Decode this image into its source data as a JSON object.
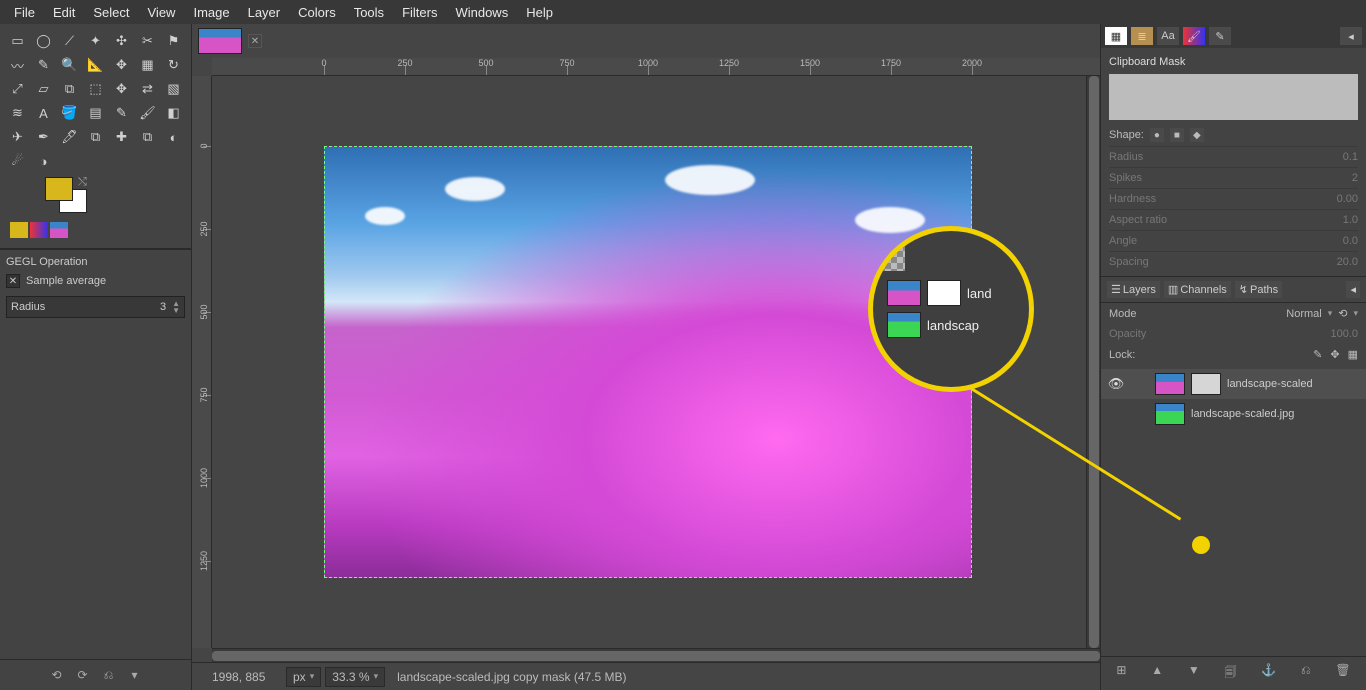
{
  "menubar": [
    "File",
    "Edit",
    "Select",
    "View",
    "Image",
    "Layer",
    "Colors",
    "Tools",
    "Filters",
    "Windows",
    "Help"
  ],
  "toolbox": {
    "tool_names": [
      "rect-select",
      "ellipse-select",
      "free-select",
      "fuzzy-select",
      "color-select",
      "scissors",
      "foreground-select",
      "paths",
      "color-picker",
      "zoom",
      "measure",
      "move",
      "align",
      "rotate",
      "scale",
      "shear",
      "perspective",
      "unified-transform",
      "handle-transform",
      "flip",
      "cage",
      "warp",
      "text",
      "bucket-fill",
      "gradient",
      "pencil",
      "paintbrush",
      "eraser",
      "airbrush",
      "ink",
      "mypaint",
      "clone",
      "heal",
      "perspective-clone",
      "blur-sharpen",
      "smudge",
      "dodge-burn"
    ],
    "glyphs": [
      "▭",
      "◯",
      "⟋",
      "✦",
      "✣",
      "✂",
      "⚑",
      "〰",
      "✎",
      "🔍",
      "📐",
      "✥",
      "▦",
      "↻",
      "⤢",
      "▱",
      "⧉",
      "⬚",
      "✥",
      "⇄",
      "▧",
      "≋",
      "A",
      "🪣",
      "▤",
      "✎",
      "🖌",
      "◧",
      "✈",
      "✒",
      "🖊",
      "⧉",
      "✚",
      "⧉",
      "◐",
      "☄",
      "◑"
    ],
    "fg_color": "#d7b71c",
    "bg_color": "#ffffff"
  },
  "tool_options": {
    "title": "GEGL Operation",
    "sample_avg_label": "Sample average",
    "radius_label": "Radius",
    "radius_value": "3"
  },
  "left_bottom_btns": [
    "⟲",
    "⟳",
    "⎌",
    "▾"
  ],
  "status": {
    "coords": "1998, 885",
    "unit": "px",
    "zoom": "33.3 %",
    "title": "landscape-scaled.jpg copy mask (47.5 MB)"
  },
  "ruler_h_labels": [
    0,
    250,
    500,
    750,
    1000,
    1250,
    1500,
    1750,
    2000
  ],
  "ruler_v_labels": [
    0,
    250,
    500,
    750,
    1000,
    1250
  ],
  "dock_tabs": [
    "▦",
    "≣",
    "Aa",
    "🖌",
    "✎"
  ],
  "brush": {
    "title": "Clipboard Mask",
    "shape_label": "Shape:",
    "props": [
      {
        "label": "Radius",
        "value": "0.1"
      },
      {
        "label": "Spikes",
        "value": "2"
      },
      {
        "label": "Hardness",
        "value": "0.00"
      },
      {
        "label": "Aspect ratio",
        "value": "1.0"
      },
      {
        "label": "Angle",
        "value": "0.0"
      },
      {
        "label": "Spacing",
        "value": "20.0"
      }
    ]
  },
  "layers": {
    "tabs": [
      "Layers",
      "Channels",
      "Paths"
    ],
    "mode_label": "Mode",
    "mode_value": "Normal",
    "opacity_label": "Opacity",
    "opacity_value": "100.0",
    "lock_label": "Lock:",
    "items": [
      {
        "name": "landscape-scaled",
        "has_mask": true,
        "visible": true,
        "selected": true
      },
      {
        "name": "landscape-scaled.jpg",
        "has_mask": false,
        "visible": false,
        "selected": false
      }
    ],
    "buttons": [
      "⊞",
      "▲",
      "▼",
      "🗐",
      "⚓",
      "⎌",
      "🗑"
    ]
  },
  "callout_rows": [
    {
      "label": "land",
      "thumb_class": "",
      "mask": true
    },
    {
      "label": "landscap",
      "thumb_class": "green",
      "mask": false
    }
  ]
}
